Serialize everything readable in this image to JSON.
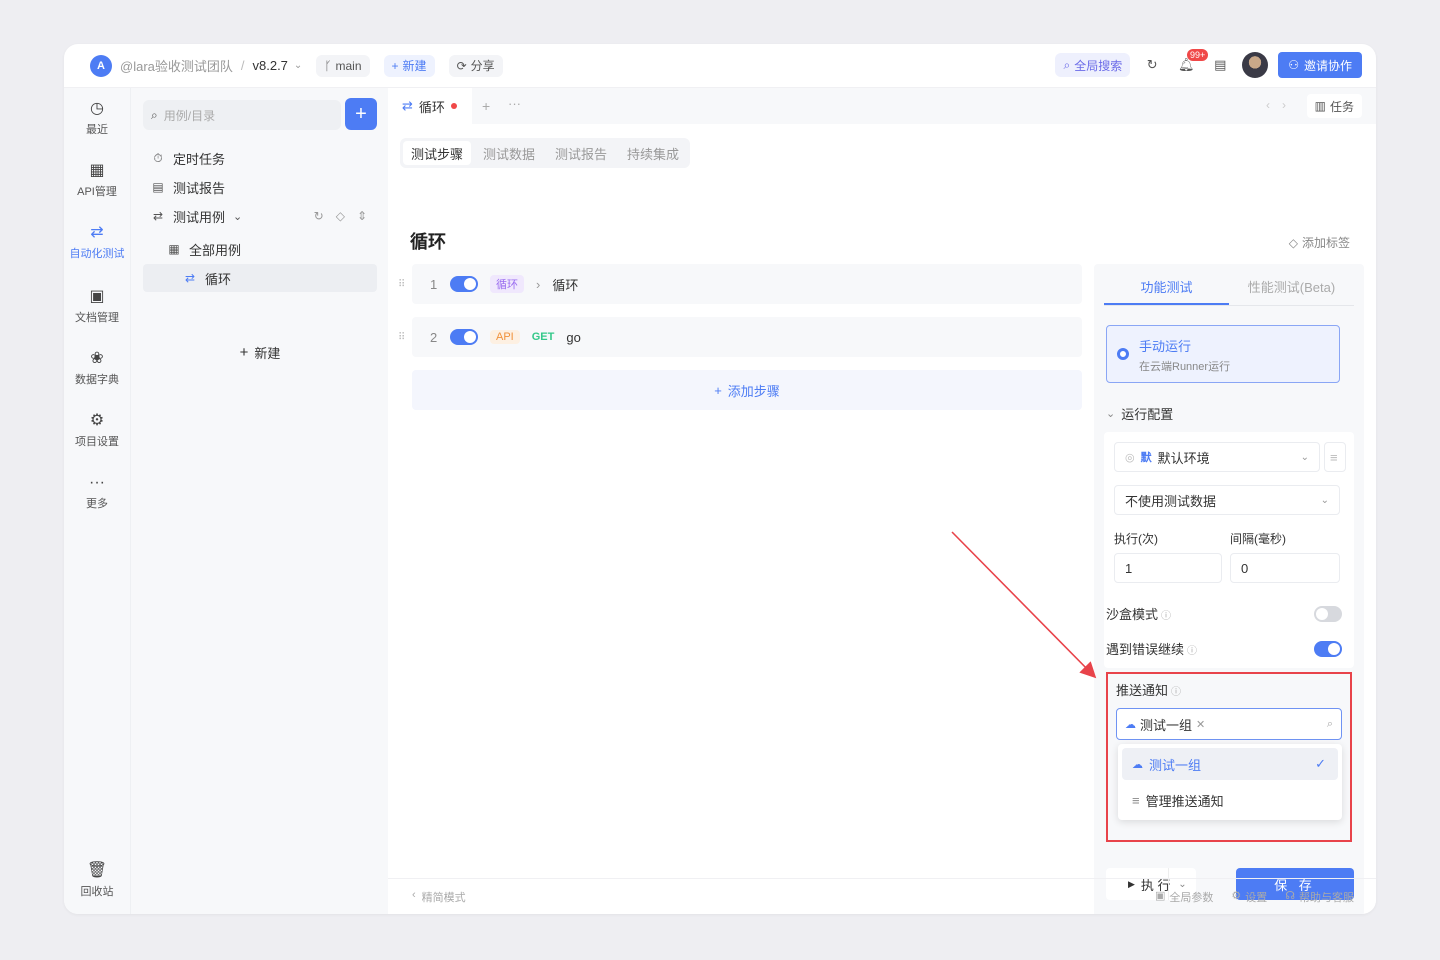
{
  "topbar": {
    "logo_text": "A",
    "team": "@lara验收测试团队",
    "separator": "/",
    "version": "v8.2.7",
    "branch": "main",
    "new_label": "新建",
    "share_label": "分享",
    "global_search": "全局搜索",
    "notification_badge": "99+",
    "invite_label": "邀请协作"
  },
  "rail": {
    "items": [
      {
        "label": "最近",
        "icon": "clock-icon"
      },
      {
        "label": "API管理",
        "icon": "api-icon"
      },
      {
        "label": "自动化测试",
        "icon": "automation-icon"
      },
      {
        "label": "文档管理",
        "icon": "document-icon"
      },
      {
        "label": "数据字典",
        "icon": "dictionary-icon"
      },
      {
        "label": "项目设置",
        "icon": "settings-icon"
      },
      {
        "label": "更多",
        "icon": "more-icon"
      },
      {
        "label": "回收站",
        "icon": "trash-icon"
      }
    ],
    "active": "自动化测试"
  },
  "tree": {
    "search_placeholder": "用例/目录",
    "items": [
      "定时任务",
      "测试报告",
      "测试用例",
      "全部用例",
      "循环"
    ],
    "new_label": "新建"
  },
  "tabs": {
    "doc_tab": "循环",
    "more": "···",
    "task_label": "任务"
  },
  "subtabs": [
    "测试步骤",
    "测试数据",
    "测试报告",
    "持续集成"
  ],
  "page": {
    "title": "循环",
    "add_tag": "添加标签"
  },
  "steps": [
    {
      "num": "1",
      "tag": "循环",
      "arrow": "›",
      "name": "循环"
    },
    {
      "num": "2",
      "tag": "API",
      "method": "GET",
      "name": "go"
    }
  ],
  "add_step": "添加步骤",
  "right_panel": {
    "tabs": [
      "功能测试",
      "性能测试(Beta)"
    ],
    "run_mode_title": "手动运行",
    "run_mode_sub": "在云端Runner运行",
    "config_label": "运行配置",
    "env_badge": "默",
    "env_label": "默认环境",
    "test_data": "不使用测试数据",
    "exec_label": "执行(次)",
    "interval_label": "间隔(毫秒)",
    "exec_value": "1",
    "interval_value": "0",
    "sandbox_label": "沙盒模式",
    "continue_label": "遇到错误继续",
    "sandbox_on": false,
    "continue_on": true,
    "notify_label": "推送通知",
    "selected_tag": "测试一组",
    "options": [
      "测试一组",
      "管理推送通知"
    ],
    "run_label": "执 行",
    "save_label": "保 存"
  },
  "footer": {
    "left": "精简模式",
    "right": [
      "全局参数",
      "设置",
      "帮助与客服"
    ]
  },
  "colors": {
    "accent": "#4d7cf4",
    "highlight": "#e8434a"
  }
}
